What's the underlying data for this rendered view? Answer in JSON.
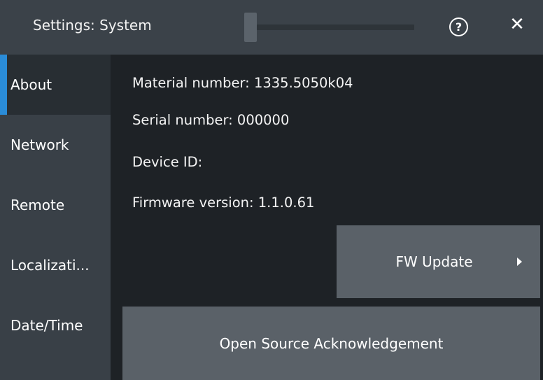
{
  "window": {
    "title": "Settings: System",
    "help_symbol": "?",
    "close_symbol": "✕"
  },
  "sidebar": {
    "items": [
      {
        "label": "About",
        "active": true
      },
      {
        "label": "Network",
        "active": false
      },
      {
        "label": "Remote",
        "active": false
      },
      {
        "label": "Localizati...",
        "active": false
      },
      {
        "label": "Date/Time",
        "active": false
      }
    ]
  },
  "about": {
    "material_number": "Material number:  1335.5050k04",
    "serial_number": "Serial number:  000000",
    "device_id": "Device ID:",
    "firmware_version": "Firmware version:  1.1.0.61"
  },
  "buttons": {
    "fw_update": "FW Update",
    "open_source": "Open Source Acknowledgement"
  },
  "colors": {
    "background": "#1e2226",
    "titlebar": "#3b4249",
    "sidebar": "#394047",
    "active_item": "#282e33",
    "accent": "#2a8cd8",
    "button": "#5a6168"
  }
}
